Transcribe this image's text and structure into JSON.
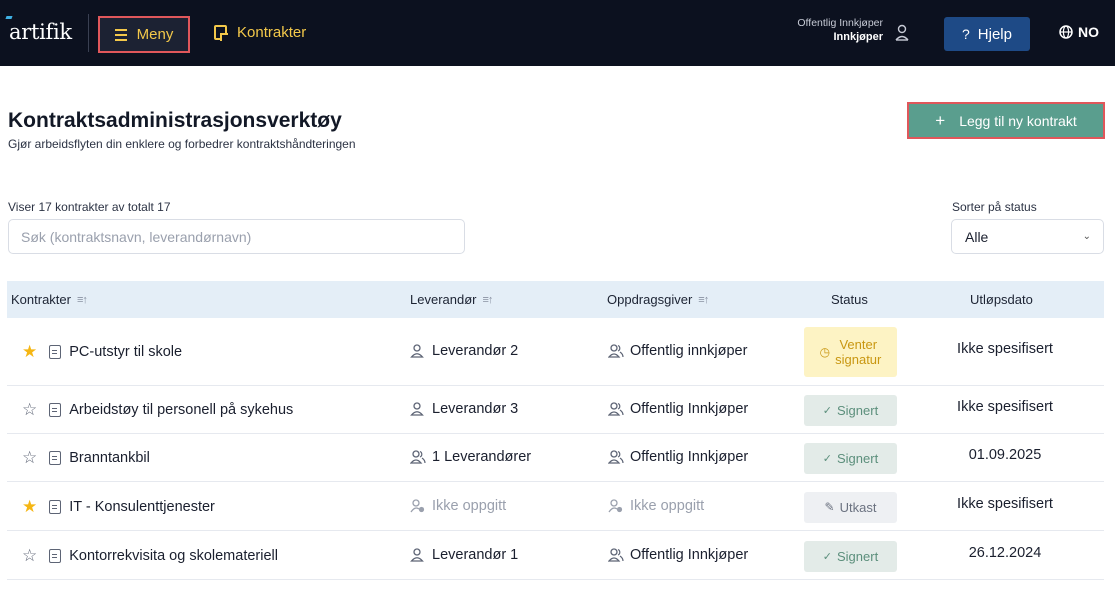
{
  "header": {
    "logo": "artifik",
    "menu_label": "Meny",
    "nav_contracts": "Kontrakter",
    "user_role": "Offentlig Innkjøper",
    "user_name": "Innkjøper",
    "help_label": "Hjelp",
    "language": "NO"
  },
  "page": {
    "title": "Kontraktsadministrasjonsverktøy",
    "subtitle": "Gjør arbeidsflyten din enklere og forbedrer kontraktshåndteringen",
    "add_button": "Legg til ny kontrakt",
    "count_text": "Viser 17 kontrakter av totalt 17",
    "search_placeholder": "Søk (kontraktsnavn, leverandørnavn)",
    "sort_label": "Sorter på status",
    "sort_value": "Alle"
  },
  "table": {
    "columns": [
      "Kontrakter",
      "Leverandør",
      "Oppdragsgiver",
      "Status",
      "Utløpsdato"
    ],
    "rows": [
      {
        "starred": true,
        "name": "PC-utstyr til skole",
        "supplier": "Leverandør 2",
        "supplier_icon": "person-icon",
        "client": "Offentlig innkjøper",
        "client_icon": "people-icon",
        "status_line1": "Venter",
        "status_line2": "signatur",
        "status_type": "waiting",
        "expiry": "Ikke spesifisert"
      },
      {
        "starred": false,
        "name": "Arbeidstøy til personell på sykehus",
        "supplier": "Leverandør 3",
        "supplier_icon": "person-icon",
        "client": "Offentlig Innkjøper",
        "client_icon": "people-icon",
        "status_line1": "Signert",
        "status_type": "signed",
        "expiry": "Ikke spesifisert"
      },
      {
        "starred": false,
        "name": "Branntankbil",
        "supplier": "1 Leverandører",
        "supplier_icon": "people-icon",
        "client": "Offentlig Innkjøper",
        "client_icon": "people-icon",
        "status_line1": "Signert",
        "status_type": "signed",
        "expiry": "01.09.2025"
      },
      {
        "starred": true,
        "name": "IT - Konsulenttjenester",
        "supplier": "Ikke oppgitt",
        "supplier_icon": "person-unknown-icon",
        "client": "Ikke oppgitt",
        "client_icon": "person-unknown-icon",
        "status_line1": "Utkast",
        "status_type": "draft",
        "expiry": "Ikke spesifisert"
      },
      {
        "starred": false,
        "name": "Kontorrekvisita og skolemateriell",
        "supplier": "Leverandør 1",
        "supplier_icon": "person-icon",
        "client": "Offentlig Innkjøper",
        "client_icon": "people-icon",
        "status_line1": "Signert",
        "status_type": "signed",
        "expiry": "26.12.2024"
      }
    ]
  },
  "colors": {
    "topbar": "#0c111f",
    "accent_yellow": "#f3c84a",
    "primary_green": "#5a9e8e",
    "help_blue": "#1e4a86",
    "table_header": "#e4eef7"
  }
}
